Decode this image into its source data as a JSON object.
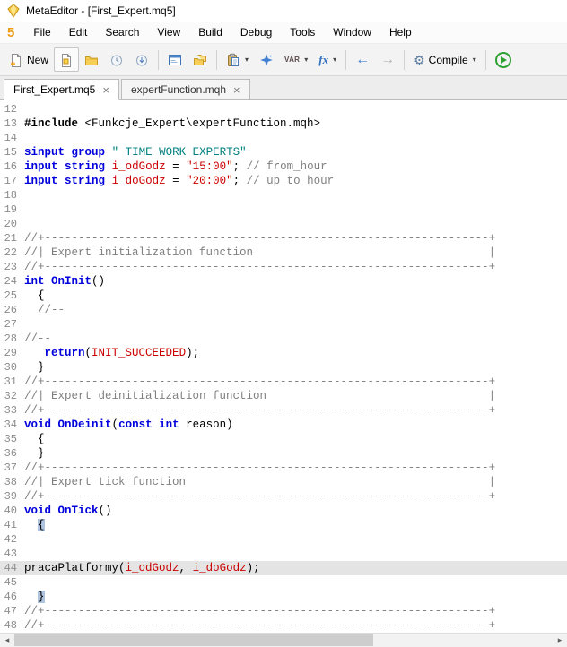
{
  "window": {
    "title": "MetaEditor - [First_Expert.mq5]"
  },
  "menu_bar": {
    "logo": "5",
    "items": [
      "File",
      "Edit",
      "Search",
      "View",
      "Build",
      "Debug",
      "Tools",
      "Window",
      "Help"
    ]
  },
  "toolbar": {
    "new_label": "New",
    "compile_label": "Compile",
    "var_label": "VAR",
    "fx_label": "fx"
  },
  "icons": {
    "chevron_down": "▾",
    "close": "×",
    "back_arrow": "←",
    "forward_arrow": "→",
    "gear": "⚙",
    "scroll_left": "◂",
    "scroll_right": "▸"
  },
  "tab_bar": {
    "tabs": [
      {
        "label": "First_Expert.mq5",
        "active": true
      },
      {
        "label": "expertFunction.mqh",
        "active": false
      }
    ]
  },
  "editor": {
    "language": "MQL5",
    "colors": {
      "keyword": "#0000dd",
      "string": "#008080",
      "comment": "#808080",
      "constant": "#cc0000",
      "default": "#000000",
      "line_number": "#8c8c8c",
      "current_line_bg": "#e4e4e4",
      "brace_match_bg": "#adc3de"
    },
    "lines": [
      {
        "n": 12,
        "s": []
      },
      {
        "n": 13,
        "s": [
          [
            "#include ",
            "pp"
          ],
          [
            "<Funkcje_Expert\\expertFunction.mqh>",
            "d"
          ]
        ]
      },
      {
        "n": 14,
        "s": []
      },
      {
        "n": 15,
        "s": [
          [
            "sinput",
            "k"
          ],
          [
            " ",
            "d"
          ],
          [
            "group",
            "k"
          ],
          [
            " ",
            "d"
          ],
          [
            "\" TIME WORK EXPERTS\"",
            "s"
          ]
        ]
      },
      {
        "n": 16,
        "s": [
          [
            "input",
            "k"
          ],
          [
            " ",
            "d"
          ],
          [
            "string",
            "k"
          ],
          [
            " ",
            "d"
          ],
          [
            "i_odGodz",
            "r"
          ],
          [
            " = ",
            "d"
          ],
          [
            "\"15:00\"",
            "r"
          ],
          [
            "; ",
            "d"
          ],
          [
            "// from_hour",
            "c"
          ]
        ]
      },
      {
        "n": 17,
        "s": [
          [
            "input",
            "k"
          ],
          [
            " ",
            "d"
          ],
          [
            "string",
            "k"
          ],
          [
            " ",
            "d"
          ],
          [
            "i_doGodz",
            "r"
          ],
          [
            " = ",
            "d"
          ],
          [
            "\"20:00\"",
            "r"
          ],
          [
            "; ",
            "d"
          ],
          [
            "// up_to_hour",
            "c"
          ]
        ]
      },
      {
        "n": 18,
        "s": []
      },
      {
        "n": 19,
        "s": []
      },
      {
        "n": 20,
        "s": []
      },
      {
        "n": 21,
        "s": [
          [
            "//+------------------------------------------------------------------+",
            "c"
          ]
        ]
      },
      {
        "n": 22,
        "s": [
          [
            "//| Expert initialization function                                   |",
            "c"
          ]
        ]
      },
      {
        "n": 23,
        "s": [
          [
            "//+------------------------------------------------------------------+",
            "c"
          ]
        ]
      },
      {
        "n": 24,
        "s": [
          [
            "int",
            "k"
          ],
          [
            " ",
            "d"
          ],
          [
            "OnInit",
            "k"
          ],
          [
            "()",
            "d"
          ]
        ]
      },
      {
        "n": 25,
        "s": [
          [
            "  {",
            "d"
          ]
        ]
      },
      {
        "n": 26,
        "s": [
          [
            "  ",
            "d"
          ],
          [
            "//--",
            "c"
          ]
        ]
      },
      {
        "n": 27,
        "s": []
      },
      {
        "n": 28,
        "s": [
          [
            "//--",
            "c"
          ]
        ]
      },
      {
        "n": 29,
        "s": [
          [
            "   ",
            "d"
          ],
          [
            "return",
            "k"
          ],
          [
            "(",
            "d"
          ],
          [
            "INIT_SUCCEEDED",
            "r"
          ],
          [
            ");",
            "d"
          ]
        ]
      },
      {
        "n": 30,
        "s": [
          [
            "  }",
            "d"
          ]
        ]
      },
      {
        "n": 31,
        "s": [
          [
            "//+------------------------------------------------------------------+",
            "c"
          ]
        ]
      },
      {
        "n": 32,
        "s": [
          [
            "//| Expert deinitialization function                                 |",
            "c"
          ]
        ]
      },
      {
        "n": 33,
        "s": [
          [
            "//+------------------------------------------------------------------+",
            "c"
          ]
        ]
      },
      {
        "n": 34,
        "s": [
          [
            "void",
            "k"
          ],
          [
            " ",
            "d"
          ],
          [
            "OnDeinit",
            "k"
          ],
          [
            "(",
            "d"
          ],
          [
            "const",
            "k"
          ],
          [
            " ",
            "d"
          ],
          [
            "int",
            "k"
          ],
          [
            " reason)",
            "d"
          ]
        ]
      },
      {
        "n": 35,
        "s": [
          [
            "  {",
            "d"
          ]
        ]
      },
      {
        "n": 36,
        "s": [
          [
            "  }",
            "d"
          ]
        ]
      },
      {
        "n": 37,
        "s": [
          [
            "//+------------------------------------------------------------------+",
            "c"
          ]
        ]
      },
      {
        "n": 38,
        "s": [
          [
            "//| Expert tick function                                             |",
            "c"
          ]
        ]
      },
      {
        "n": 39,
        "s": [
          [
            "//+------------------------------------------------------------------+",
            "c"
          ]
        ]
      },
      {
        "n": 40,
        "s": [
          [
            "void",
            "k"
          ],
          [
            " ",
            "d"
          ],
          [
            "OnTick",
            "k"
          ],
          [
            "()",
            "d"
          ]
        ]
      },
      {
        "n": 41,
        "s": [
          [
            "  ",
            "d"
          ],
          [
            "{",
            "b"
          ]
        ]
      },
      {
        "n": 42,
        "s": []
      },
      {
        "n": 43,
        "s": []
      },
      {
        "n": 44,
        "h": true,
        "s": [
          [
            "pracaPlatformy(",
            "d"
          ],
          [
            "i_odGodz",
            "r"
          ],
          [
            ", ",
            "d"
          ],
          [
            "i_doGodz",
            "r"
          ],
          [
            ");",
            "d"
          ]
        ]
      },
      {
        "n": 45,
        "s": []
      },
      {
        "n": 46,
        "s": [
          [
            "  ",
            "d"
          ],
          [
            "}",
            "b"
          ]
        ]
      },
      {
        "n": 47,
        "s": [
          [
            "//+------------------------------------------------------------------+",
            "c"
          ]
        ]
      },
      {
        "n": 48,
        "s": [
          [
            "//+------------------------------------------------------------------+",
            "c"
          ]
        ]
      }
    ]
  }
}
